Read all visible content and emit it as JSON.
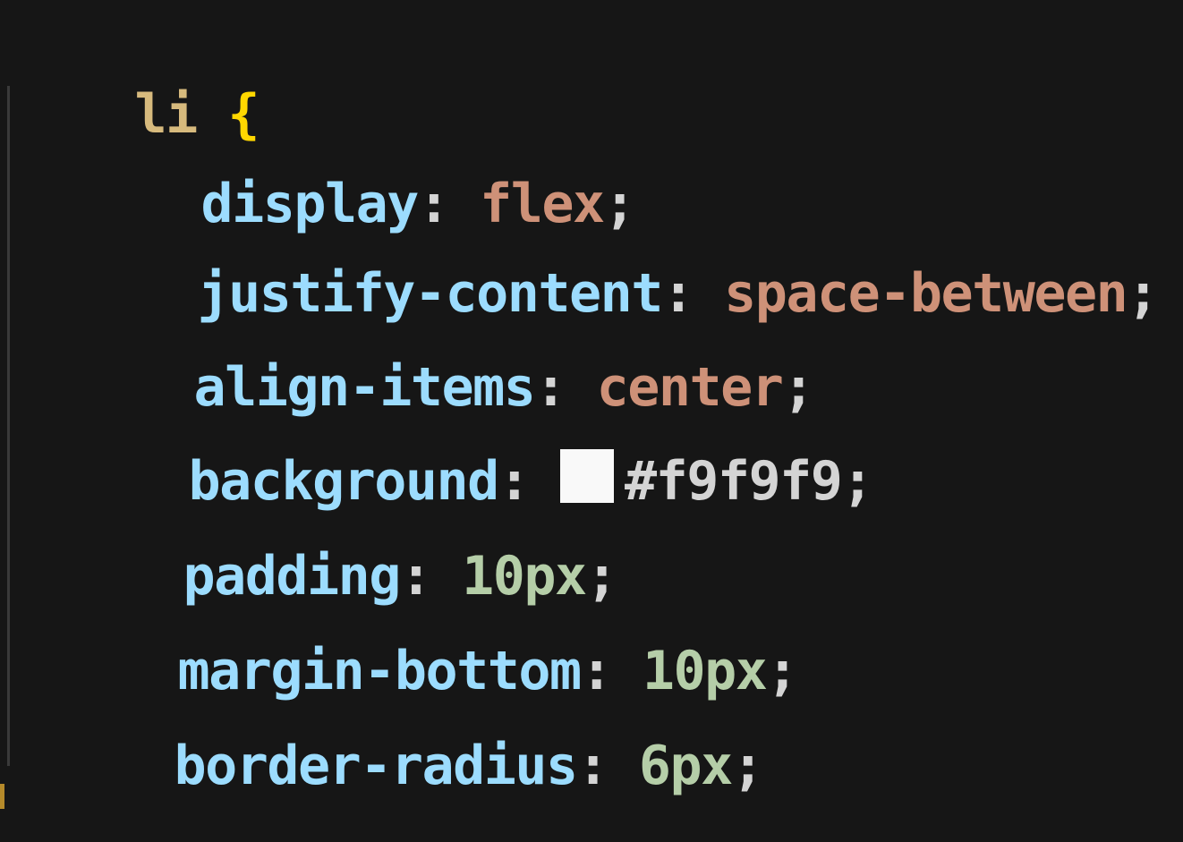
{
  "code": {
    "selector": "li",
    "open_brace": "{",
    "declarations": [
      {
        "property": "display",
        "value": "flex"
      },
      {
        "property": "justify-content",
        "value": "space-between"
      },
      {
        "property": "align-items",
        "value": "center"
      },
      {
        "property": "background",
        "value": "#f9f9f9",
        "swatch_color": "#f9f9f9"
      },
      {
        "property": "padding",
        "value": "10px"
      },
      {
        "property": "margin-bottom",
        "value": "10px"
      },
      {
        "property": "border-radius",
        "value": "6px"
      }
    ],
    "colon": ":",
    "semicolon": ";"
  }
}
